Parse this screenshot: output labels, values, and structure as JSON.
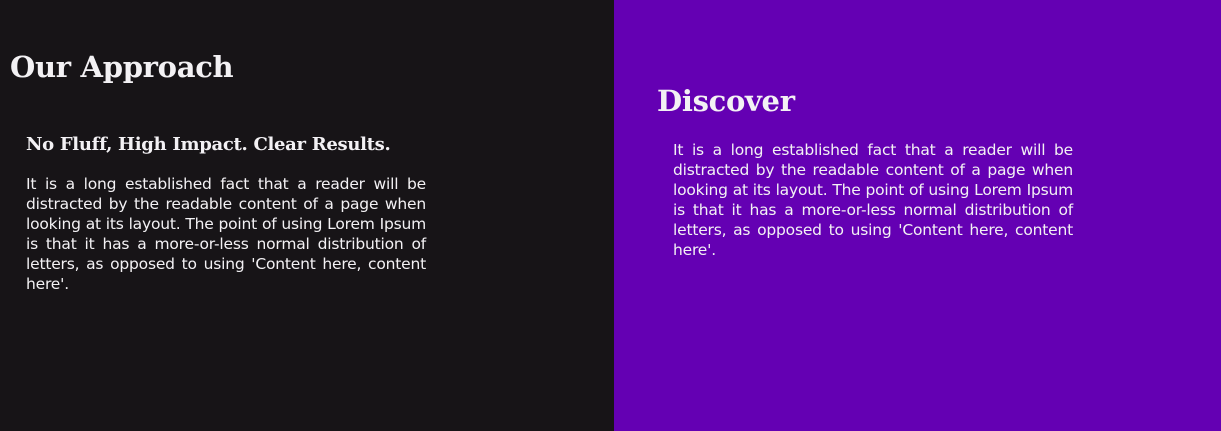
{
  "approach": {
    "title": "Our Approach",
    "subtitle": "No Fluff, High Impact. Clear Results.",
    "body": "It is a long established fact that a reader will be distracted by the readable content of a page when looking at its layout. The point of using Lorem Ipsum is that it has a more-or-less normal distribution of letters, as opposed to using 'Content here, content here'."
  },
  "discover": {
    "title": "Discover",
    "body": "It is a long established fact that a reader will be distracted by the readable content of a page when looking at its layout. The point of using Lorem Ipsum is that it has a more-or-less normal distribution of letters, as opposed to using 'Content here, content here'."
  },
  "colors": {
    "left_background": "#171417",
    "right_background": "#6400b3",
    "text": "#f3f1f4"
  }
}
